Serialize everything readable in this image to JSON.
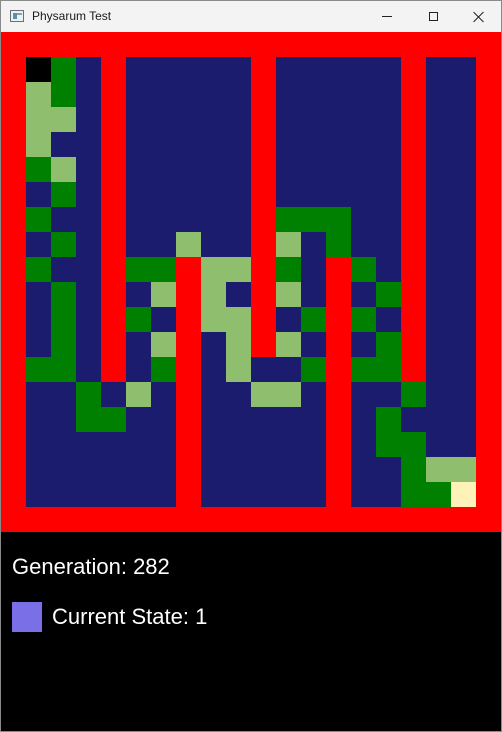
{
  "window": {
    "title": "Physarum Test",
    "controls": [
      "minimize",
      "maximize",
      "close"
    ]
  },
  "board": {
    "rows": 20,
    "cols": 20,
    "palette": {
      "W": "#ff0000",
      "B": "#1c1c6e",
      "G": "#008000",
      "L": "#8fbf6e",
      "K": "#000000",
      "Y": "#fff2b8"
    },
    "grid": [
      "WWWWWWWWWWWWWWWWWWWW",
      "WKGBWBBBBBWBBBBBWBBW",
      "WLGBWBBBBBWBBBBBWBBW",
      "WLLBWBBBBBWBBBBBWBBW",
      "WLBBWBBBBBWBBBBBWBBW",
      "WGLBWBBBBBWBBBBBWBBW",
      "WBGBWBBBBBWBBBBBWBBW",
      "WGBBWBBBBBWGGGBBWBBW",
      "WBGBWBBLBBWLBGBBWBBW",
      "WGBBWGGWLLWGBWGBWBBW",
      "WBGBWBLWLBWLBWBGWBBW",
      "WBGBWGBWLLWBGWGBWBBW",
      "WBGBWBLWBLWLBWBGWBBW",
      "WGGBWBGWBLBBGWGGWBBW",
      "WBBGBLBWBBLLBWBBGBBW",
      "WBBGGBBWBBBBBWBGBBBW",
      "WBBBBBBWBBBBBWBGGBBW",
      "WBBBBBBWBBBBBWBBGLLW",
      "WBBBBBBWBBBBBWBBGGYW",
      "WWWWWWWWWWWWWWWWWWWW"
    ]
  },
  "status": {
    "generation_label": "Generation: 282",
    "state_label": "Current State: 1",
    "state_color": "#7b6fe8"
  }
}
